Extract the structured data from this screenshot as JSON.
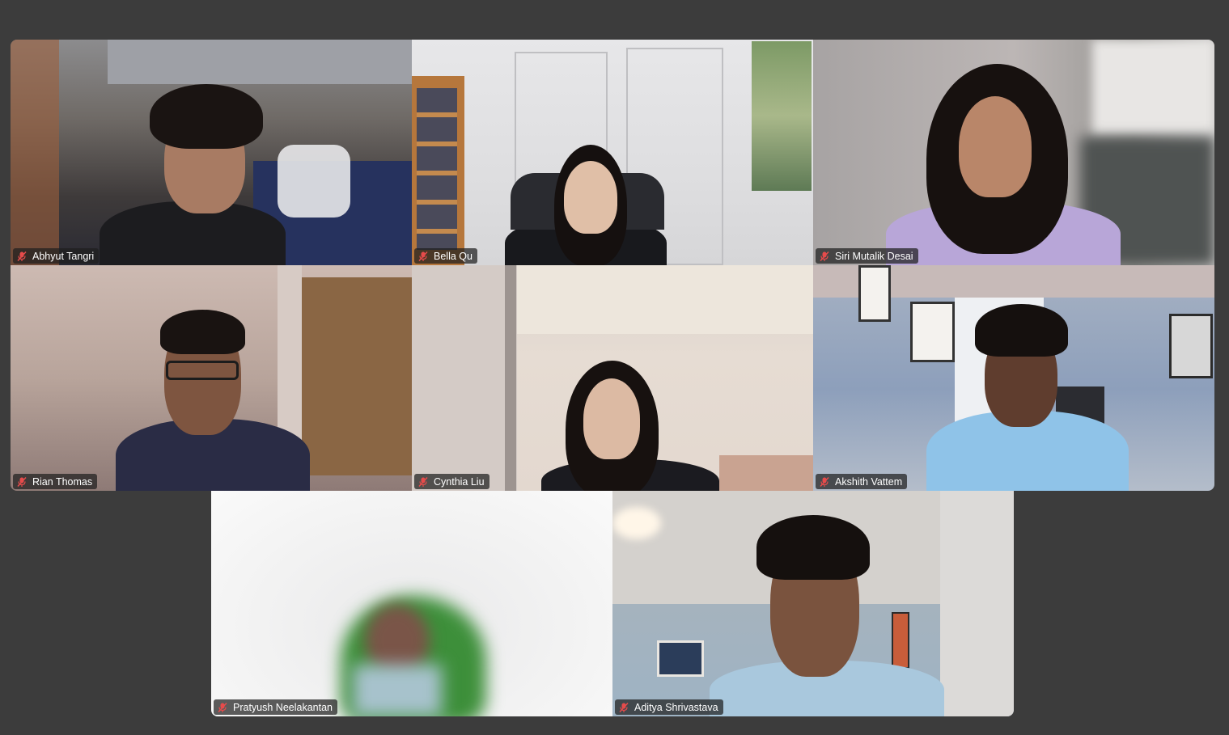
{
  "meeting": {
    "active_speaker_color": "#35d07f",
    "background_color": "#3c3c3c",
    "mic_state": "muted",
    "mic_icon": "mic-muted-icon"
  },
  "participants": [
    {
      "name": "Abhyut Tangri",
      "muted": true,
      "active": false
    },
    {
      "name": "Bella Qu",
      "muted": true,
      "active": true
    },
    {
      "name": "Siri Mutalik Desai",
      "muted": true,
      "active": false
    },
    {
      "name": "Rian Thomas",
      "muted": true,
      "active": false
    },
    {
      "name": "Cynthia Liu",
      "muted": true,
      "active": false
    },
    {
      "name": "Akshith Vattem",
      "muted": true,
      "active": false
    },
    {
      "name": "Pratyush Neelakantan",
      "muted": true,
      "active": false
    },
    {
      "name": "Aditya Shrivastava",
      "muted": true,
      "active": false
    }
  ]
}
